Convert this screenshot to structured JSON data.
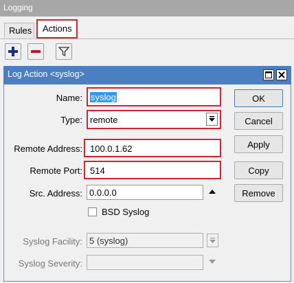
{
  "window": {
    "title": "Logging"
  },
  "tabs": [
    {
      "label": "Rules"
    },
    {
      "label": "Actions"
    }
  ],
  "dialog": {
    "title": "Log Action <syslog>",
    "fields": {
      "name": {
        "label": "Name:",
        "value": "syslog"
      },
      "type": {
        "label": "Type:",
        "value": "remote"
      },
      "remote_address": {
        "label": "Remote Address:",
        "value": "100.0.1.62"
      },
      "remote_port": {
        "label": "Remote Port:",
        "value": "514"
      },
      "src_address": {
        "label": "Src. Address:",
        "value": "0.0.0.0"
      },
      "bsd_syslog": {
        "label": "BSD Syslog",
        "checked": false
      },
      "syslog_facility": {
        "label": "Syslog Facility:",
        "value": "5 (syslog)"
      },
      "syslog_severity": {
        "label": "Syslog Severity:",
        "value": ""
      }
    },
    "buttons": {
      "ok": "OK",
      "cancel": "Cancel",
      "apply": "Apply",
      "copy": "Copy",
      "remove": "Remove"
    }
  },
  "colors": {
    "highlight": "#d3232f",
    "title_bar": "#4c7fc2",
    "selection": "#3399ff"
  },
  "icons": [
    "plus-icon",
    "minus-icon",
    "filter-icon",
    "maximize-icon",
    "close-icon",
    "dropdown-icon",
    "up-arrow-icon"
  ]
}
